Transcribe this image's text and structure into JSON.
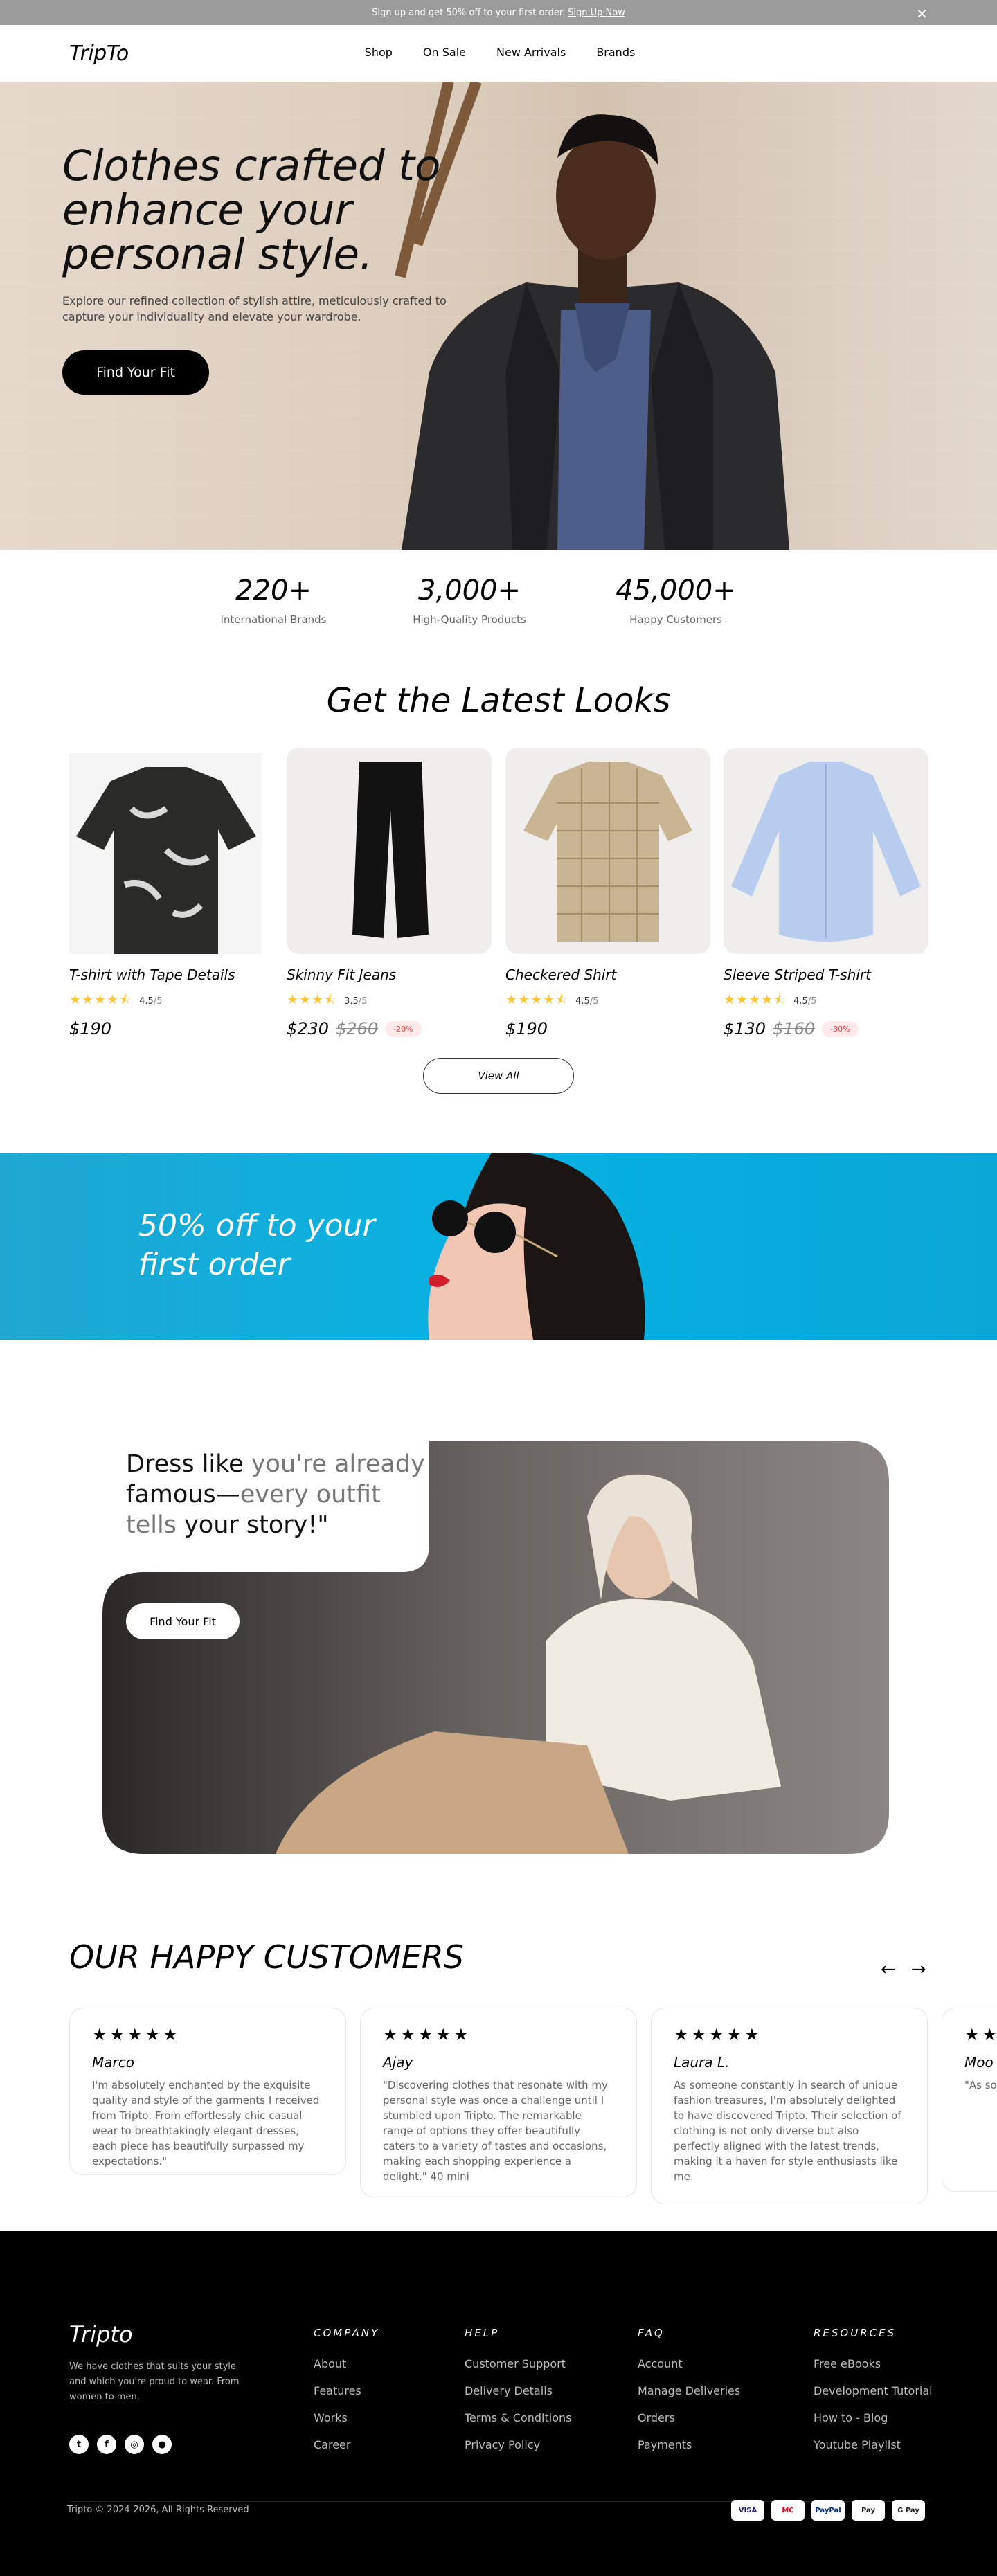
{
  "promo": {
    "text": "Sign up and get 50% off to your first order.",
    "link": "Sign Up Now"
  },
  "nav": {
    "logo": "TripTo",
    "items": [
      "Shop",
      "On Sale",
      "New Arrivals",
      "Brands"
    ]
  },
  "hero": {
    "title": "Clothes crafted to enhance your personal style.",
    "subtitle": "Explore our refined collection of stylish attire, meticulously crafted to capture your individuality and elevate your wardrobe.",
    "cta": "Find Your Fit"
  },
  "stats": [
    {
      "num": "220+",
      "label": "International Brands"
    },
    {
      "num": "3,000+",
      "label": "High-Quality Products"
    },
    {
      "num": "45,000+",
      "label": "Happy Customers"
    }
  ],
  "looks": {
    "title": "Get the Latest Looks",
    "view_all": "View All",
    "products": [
      {
        "name": "T-shirt with Tape Details",
        "rating": "4.5",
        "of": "/5",
        "stars": "★★★★⯪",
        "price": "$190",
        "old": "",
        "badge": ""
      },
      {
        "name": "Skinny Fit Jeans",
        "rating": "3.5",
        "of": "/5",
        "stars": "★★★⯪",
        "price": "$230",
        "old": "$260",
        "badge": "-20%"
      },
      {
        "name": "Checkered Shirt",
        "rating": "4.5",
        "of": "/5",
        "stars": "★★★★⯪",
        "price": "$190",
        "old": "",
        "badge": ""
      },
      {
        "name": "Sleeve Striped T-shirt",
        "rating": "4.5",
        "of": "/5",
        "stars": "★★★★⯪",
        "price": "$130",
        "old": "$160",
        "badge": "-30%"
      }
    ]
  },
  "banner": {
    "text": "50% off to your first order"
  },
  "story": {
    "dark": [
      "Dress like",
      "famous—",
      "your story!\""
    ],
    "light": [
      "you're already",
      "every outfit tells"
    ],
    "cta": "Find Your Fit"
  },
  "customers": {
    "title": "OUR HAPPY CUSTOMERS",
    "reviews": [
      {
        "stars": "★★★★★",
        "name": "Marco",
        "text": "I'm absolutely enchanted by the exquisite quality and style of the garments I received from Tripto. From effortlessly chic casual wear to breathtakingly elegant dresses, each piece has beautifully surpassed my expectations.\""
      },
      {
        "stars": "★★★★★",
        "name": "Ajay",
        "text": "\"Discovering clothes that resonate with my personal style was once a challenge until I stumbled upon Tripto. The remarkable range of options they offer beautifully caters to a variety of tastes and occasions, making each shopping experience a delight.\" 40 mini"
      },
      {
        "stars": "★★★★★",
        "name": "Laura L.",
        "text": "As someone constantly in search of unique fashion treasures, I'm absolutely delighted to have discovered Tripto. Their selection of clothing is not only diverse but also perfectly aligned with the latest trends, making it a haven for style enthusiasts like me."
      },
      {
        "stars": "★★★★★",
        "name": "Moo",
        "text": "\"As so for unie have s clot point w"
      }
    ]
  },
  "footer": {
    "logo": "Tripto",
    "desc": "We have clothes that suits your style and which you're proud to wear. From women to men.",
    "columns": [
      {
        "heading": "COMPANY",
        "items": [
          "About",
          "Features",
          "Works",
          "Career"
        ]
      },
      {
        "heading": "HELP",
        "items": [
          "Customer Support",
          "Delivery Details",
          "Terms & Conditions",
          "Privacy Policy"
        ]
      },
      {
        "heading": "FAQ",
        "items": [
          "Account",
          "Manage Deliveries",
          "Orders",
          "Payments"
        ]
      },
      {
        "heading": "RESOURCES",
        "items": [
          "Free eBooks",
          "Development Tutorial",
          "How to - Blog",
          "Youtube Playlist"
        ]
      }
    ],
    "copyright": "Tripto © 2024-2026, All Rights Reserved",
    "payments": [
      "VISA",
      "MC",
      "PayPal",
      "Pay",
      "G Pay"
    ]
  }
}
